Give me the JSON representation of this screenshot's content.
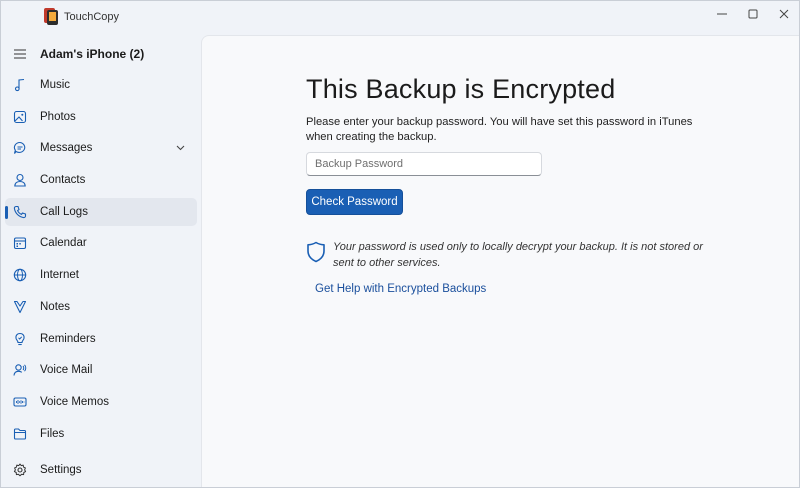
{
  "window": {
    "title": "TouchCopy",
    "controls": {
      "minimize": "minimize-icon",
      "maximize": "maximize-icon",
      "close": "close-icon"
    }
  },
  "sidebar": {
    "menu_icon": "hamburger-icon",
    "device_name": "Adam's iPhone (2)",
    "items": [
      {
        "label": "Music",
        "icon": "music-note-icon"
      },
      {
        "label": "Photos",
        "icon": "photo-icon"
      },
      {
        "label": "Messages",
        "icon": "message-bubble-icon",
        "expandable": true
      },
      {
        "label": "Contacts",
        "icon": "person-icon"
      },
      {
        "label": "Call Logs",
        "icon": "phone-icon",
        "active": true
      },
      {
        "label": "Calendar",
        "icon": "calendar-icon"
      },
      {
        "label": "Internet",
        "icon": "globe-icon"
      },
      {
        "label": "Notes",
        "icon": "notes-icon"
      },
      {
        "label": "Reminders",
        "icon": "reminder-icon"
      },
      {
        "label": "Voice Mail",
        "icon": "voicemail-icon"
      },
      {
        "label": "Voice Memos",
        "icon": "voice-memo-icon"
      },
      {
        "label": "Files",
        "icon": "folder-icon"
      }
    ],
    "settings": {
      "label": "Settings",
      "icon": "gear-icon"
    }
  },
  "main": {
    "heading": "This Backup is Encrypted",
    "description": "Please enter your backup password. You will have set this password in iTunes when creating the backup.",
    "password_placeholder": "Backup Password",
    "check_button": "Check Password",
    "note": "Your password is used only to locally decrypt your backup. It is not stored or sent to other services.",
    "help_link": "Get Help with Encrypted Backups"
  },
  "colors": {
    "accent": "#1a5fb4",
    "link": "#1a4f9c",
    "sidebar_bg": "#f0f3f8",
    "content_bg": "#f8f9fb"
  }
}
